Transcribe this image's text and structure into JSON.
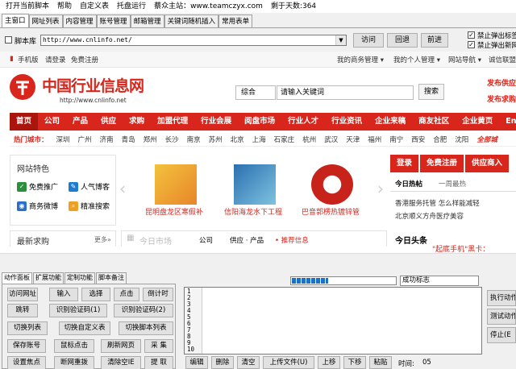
{
  "menubar": [
    "打开当前脚本",
    "帮助",
    "自定义表",
    "托盘运行",
    "蔡众主站：www.teamczyx.com",
    "剩于天数:364"
  ],
  "tabs": [
    "主窗口",
    "网址列表",
    "内容管理",
    "账号管理",
    "邮箱管理",
    "关键词随机插入",
    "常用表单"
  ],
  "address": {
    "script_lib_label": "脚本库",
    "url": "http://www.cnlinfo.net/",
    "visit": "访问",
    "back": "回退",
    "forward": "前进",
    "block_popup1": "禁止弹出标签",
    "block_popup2": "禁止弹出新网"
  },
  "web": {
    "topstrip": {
      "mobile": "手机版",
      "login": "请登录",
      "register": "免费注册",
      "my_business": "我的商务管理 ▾",
      "my_account": "我的个人管理 ▾",
      "site_nav": "网站导航 ▾",
      "cert": "诚信联盟"
    },
    "logo_text": "中国行业信息网",
    "logo_url": "http://www.cnlinfo.net",
    "search": {
      "select": "综合",
      "placeholder": "请输入关键词",
      "button": "搜索"
    },
    "publish1": "发布供应",
    "publish2": "发布求购",
    "nav": [
      "首页",
      "公司",
      "产品",
      "供应",
      "求购",
      "加盟代理",
      "行业会展",
      "阅盘市场",
      "行业人才",
      "行业资讯",
      "企业来稿",
      "商友社区",
      "企业黄页",
      "English"
    ],
    "cities_label": "热门城市：",
    "cities": [
      "深圳",
      "广州",
      "济南",
      "青岛",
      "郑州",
      "长沙",
      "南京",
      "苏州",
      "北京",
      "上海",
      "石家庄",
      "杭州",
      "武汉",
      "天津",
      "福州",
      "南宁",
      "西安",
      "合肥",
      "沈阳"
    ],
    "cities_more": "全部城",
    "features_title": "网站特色",
    "features": [
      "免费推广",
      "人气博客",
      "商务微博",
      "精准搜索"
    ],
    "carousel": [
      "昆明盘龙区寒假补",
      "信阳海龙水下工程",
      "巴音郭楞热镀锌管"
    ],
    "right_tabs": [
      "登录",
      "免费注册",
      "供应商入"
    ],
    "hot_tabs": [
      "今日热帖",
      "一周最热"
    ],
    "hot_items": [
      "香港服务托管 怎么样能减轻",
      "北京顺义方舟医疗美容"
    ],
    "latest_title": "最新求购",
    "latest_more": "更多»",
    "market_title": "今日市场",
    "market_tabs": [
      "公司",
      "供应 · 产品",
      "• 推荐信息"
    ],
    "headline_title": "今日头条",
    "headline_text": "\"起底手机\"黑卡："
  },
  "panel": {
    "tabs": [
      "动作面板",
      "扩展功能",
      "定制功能",
      "脚本备注"
    ],
    "buttons": [
      [
        "访问网址",
        "输入",
        "选择",
        "点击",
        "倒计时"
      ],
      [
        "跳转",
        "识别验证码(1)",
        "识别验证码(2)"
      ],
      [
        "切换列表",
        "切换自定义表",
        "切换脚本列表"
      ],
      [
        "保存账号",
        "鼠标点击",
        "刷新网页",
        "采 集"
      ],
      [
        "设置焦点",
        "断网重拨",
        "清除空IE",
        "提 取"
      ]
    ]
  },
  "status": {
    "progress_pct": 35,
    "flag_label": "成功标志"
  },
  "editor": {
    "lines": [
      "1",
      "2",
      "3",
      "4",
      "5",
      "6",
      "7",
      "8",
      "9",
      "10"
    ],
    "buttons": [
      "编辑",
      "删除",
      "清空",
      "上传文件(U)",
      "上移",
      "下移",
      "粘贴"
    ],
    "time_label": "时间:",
    "time_value": "05"
  },
  "right_buttons": [
    "执行动作",
    "测试动作",
    "停止(E"
  ]
}
